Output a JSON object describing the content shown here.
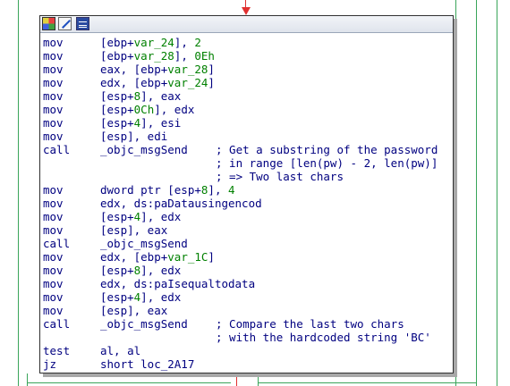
{
  "colors": {
    "edge_green": "#3aa55a",
    "edge_red": "#e03030",
    "code_blue": "#000080",
    "number_green": "#008000"
  },
  "header_icons": [
    "color-palette-icon",
    "edit-pencil-icon",
    "list-view-icon"
  ],
  "lines": [
    {
      "mn": "mov",
      "op": [
        [
          "t",
          "[ebp+"
        ],
        [
          "v",
          "var_24"
        ],
        [
          "t",
          "], "
        ],
        [
          "n",
          "2"
        ]
      ],
      "cm": ""
    },
    {
      "mn": "mov",
      "op": [
        [
          "t",
          "[ebp+"
        ],
        [
          "v",
          "var_28"
        ],
        [
          "t",
          "], "
        ],
        [
          "n",
          "0Eh"
        ]
      ],
      "cm": ""
    },
    {
      "mn": "mov",
      "op": [
        [
          "t",
          "eax, [ebp+"
        ],
        [
          "v",
          "var_28"
        ],
        [
          "t",
          "]"
        ]
      ],
      "cm": ""
    },
    {
      "mn": "mov",
      "op": [
        [
          "t",
          "edx, [ebp+"
        ],
        [
          "v",
          "var_24"
        ],
        [
          "t",
          "]"
        ]
      ],
      "cm": ""
    },
    {
      "mn": "mov",
      "op": [
        [
          "t",
          "[esp+"
        ],
        [
          "n",
          "8"
        ],
        [
          "t",
          "], eax"
        ]
      ],
      "cm": ""
    },
    {
      "mn": "mov",
      "op": [
        [
          "t",
          "[esp+"
        ],
        [
          "n",
          "0Ch"
        ],
        [
          "t",
          "], edx"
        ]
      ],
      "cm": ""
    },
    {
      "mn": "mov",
      "op": [
        [
          "t",
          "[esp+"
        ],
        [
          "n",
          "4"
        ],
        [
          "t",
          "], esi"
        ]
      ],
      "cm": ""
    },
    {
      "mn": "mov",
      "op": [
        [
          "t",
          "[esp], edi"
        ]
      ],
      "cm": ""
    },
    {
      "mn": "call",
      "op": [
        [
          "t",
          "_objc_msgSend"
        ]
      ],
      "cm": "; Get a substring of the password"
    },
    {
      "mn": "",
      "op": [],
      "cm": "; in range [len(pw) - 2, len(pw)]"
    },
    {
      "mn": "",
      "op": [],
      "cm": "; => Two last chars"
    },
    {
      "mn": "mov",
      "op": [
        [
          "t",
          "dword ptr [esp+"
        ],
        [
          "n",
          "8"
        ],
        [
          "t",
          "], "
        ],
        [
          "n",
          "4"
        ]
      ],
      "cm": ""
    },
    {
      "mn": "mov",
      "op": [
        [
          "t",
          "edx, ds:"
        ],
        [
          "t",
          "paDatausingencod"
        ]
      ],
      "cm": ""
    },
    {
      "mn": "mov",
      "op": [
        [
          "t",
          "[esp+"
        ],
        [
          "n",
          "4"
        ],
        [
          "t",
          "], edx"
        ]
      ],
      "cm": ""
    },
    {
      "mn": "mov",
      "op": [
        [
          "t",
          "[esp], eax"
        ]
      ],
      "cm": ""
    },
    {
      "mn": "call",
      "op": [
        [
          "t",
          "_objc_msgSend"
        ]
      ],
      "cm": ""
    },
    {
      "mn": "mov",
      "op": [
        [
          "t",
          "edx, [ebp+"
        ],
        [
          "v",
          "var_1C"
        ],
        [
          "t",
          "]"
        ]
      ],
      "cm": ""
    },
    {
      "mn": "mov",
      "op": [
        [
          "t",
          "[esp+"
        ],
        [
          "n",
          "8"
        ],
        [
          "t",
          "], edx"
        ]
      ],
      "cm": ""
    },
    {
      "mn": "mov",
      "op": [
        [
          "t",
          "edx, ds:"
        ],
        [
          "t",
          "paIsequaltodata"
        ]
      ],
      "cm": ""
    },
    {
      "mn": "mov",
      "op": [
        [
          "t",
          "[esp+"
        ],
        [
          "n",
          "4"
        ],
        [
          "t",
          "], edx"
        ]
      ],
      "cm": ""
    },
    {
      "mn": "mov",
      "op": [
        [
          "t",
          "[esp], eax"
        ]
      ],
      "cm": ""
    },
    {
      "mn": "call",
      "op": [
        [
          "t",
          "_objc_msgSend"
        ]
      ],
      "cm": "; Compare the last two chars"
    },
    {
      "mn": "",
      "op": [],
      "cm": "; with the hardcoded string 'BC'"
    },
    {
      "mn": "test",
      "op": [
        [
          "t",
          "al, al"
        ]
      ],
      "cm": ""
    },
    {
      "mn": "jz",
      "op": [
        [
          "t",
          "short loc_2A17"
        ]
      ],
      "cm": ""
    }
  ]
}
